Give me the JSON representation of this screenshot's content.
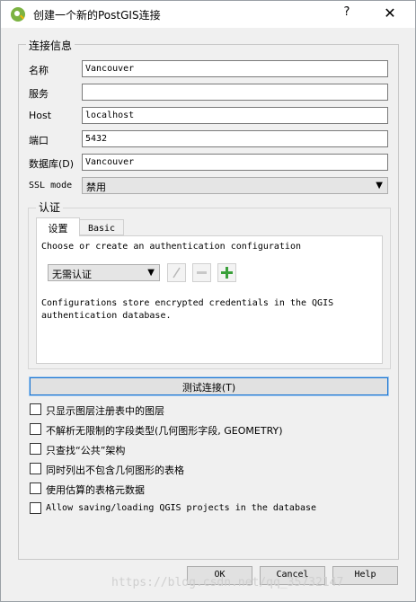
{
  "window": {
    "title": "创建一个新的PostGIS连接",
    "help_label": "?",
    "close_label": "✕"
  },
  "connection_group": {
    "title": "连接信息",
    "fields": [
      {
        "label": "名称",
        "value": "Vancouver"
      },
      {
        "label": "服务",
        "value": ""
      },
      {
        "label": "Host",
        "value": "localhost"
      },
      {
        "label": "端口",
        "value": "5432"
      },
      {
        "label": "数据库(D)",
        "value": "Vancouver"
      }
    ],
    "ssl_mode": {
      "label": "SSL mode",
      "value": "禁用"
    }
  },
  "auth": {
    "title": "认证",
    "tabs": [
      "设置",
      "Basic"
    ],
    "choose_text": "Choose or create an authentication configuration",
    "config_select": "无需认证",
    "note_line1": "Configurations store encrypted credentials in the QGIS",
    "note_line2": "authentication database."
  },
  "test_connection_label": "测试连接(T)",
  "options": [
    "只显示图层注册表中的图层",
    "不解析无限制的字段类型(几何图形字段, GEOMETRY)",
    "只查找“公共”架构",
    "同时列出不包含几何图形的表格",
    "使用估算的表格元数据",
    "Allow saving/loading QGIS projects in the database"
  ],
  "buttons": {
    "ok": "OK",
    "cancel": "Cancel",
    "help": "Help"
  },
  "watermark": "https://blog.csdn.net/qq_35732147"
}
